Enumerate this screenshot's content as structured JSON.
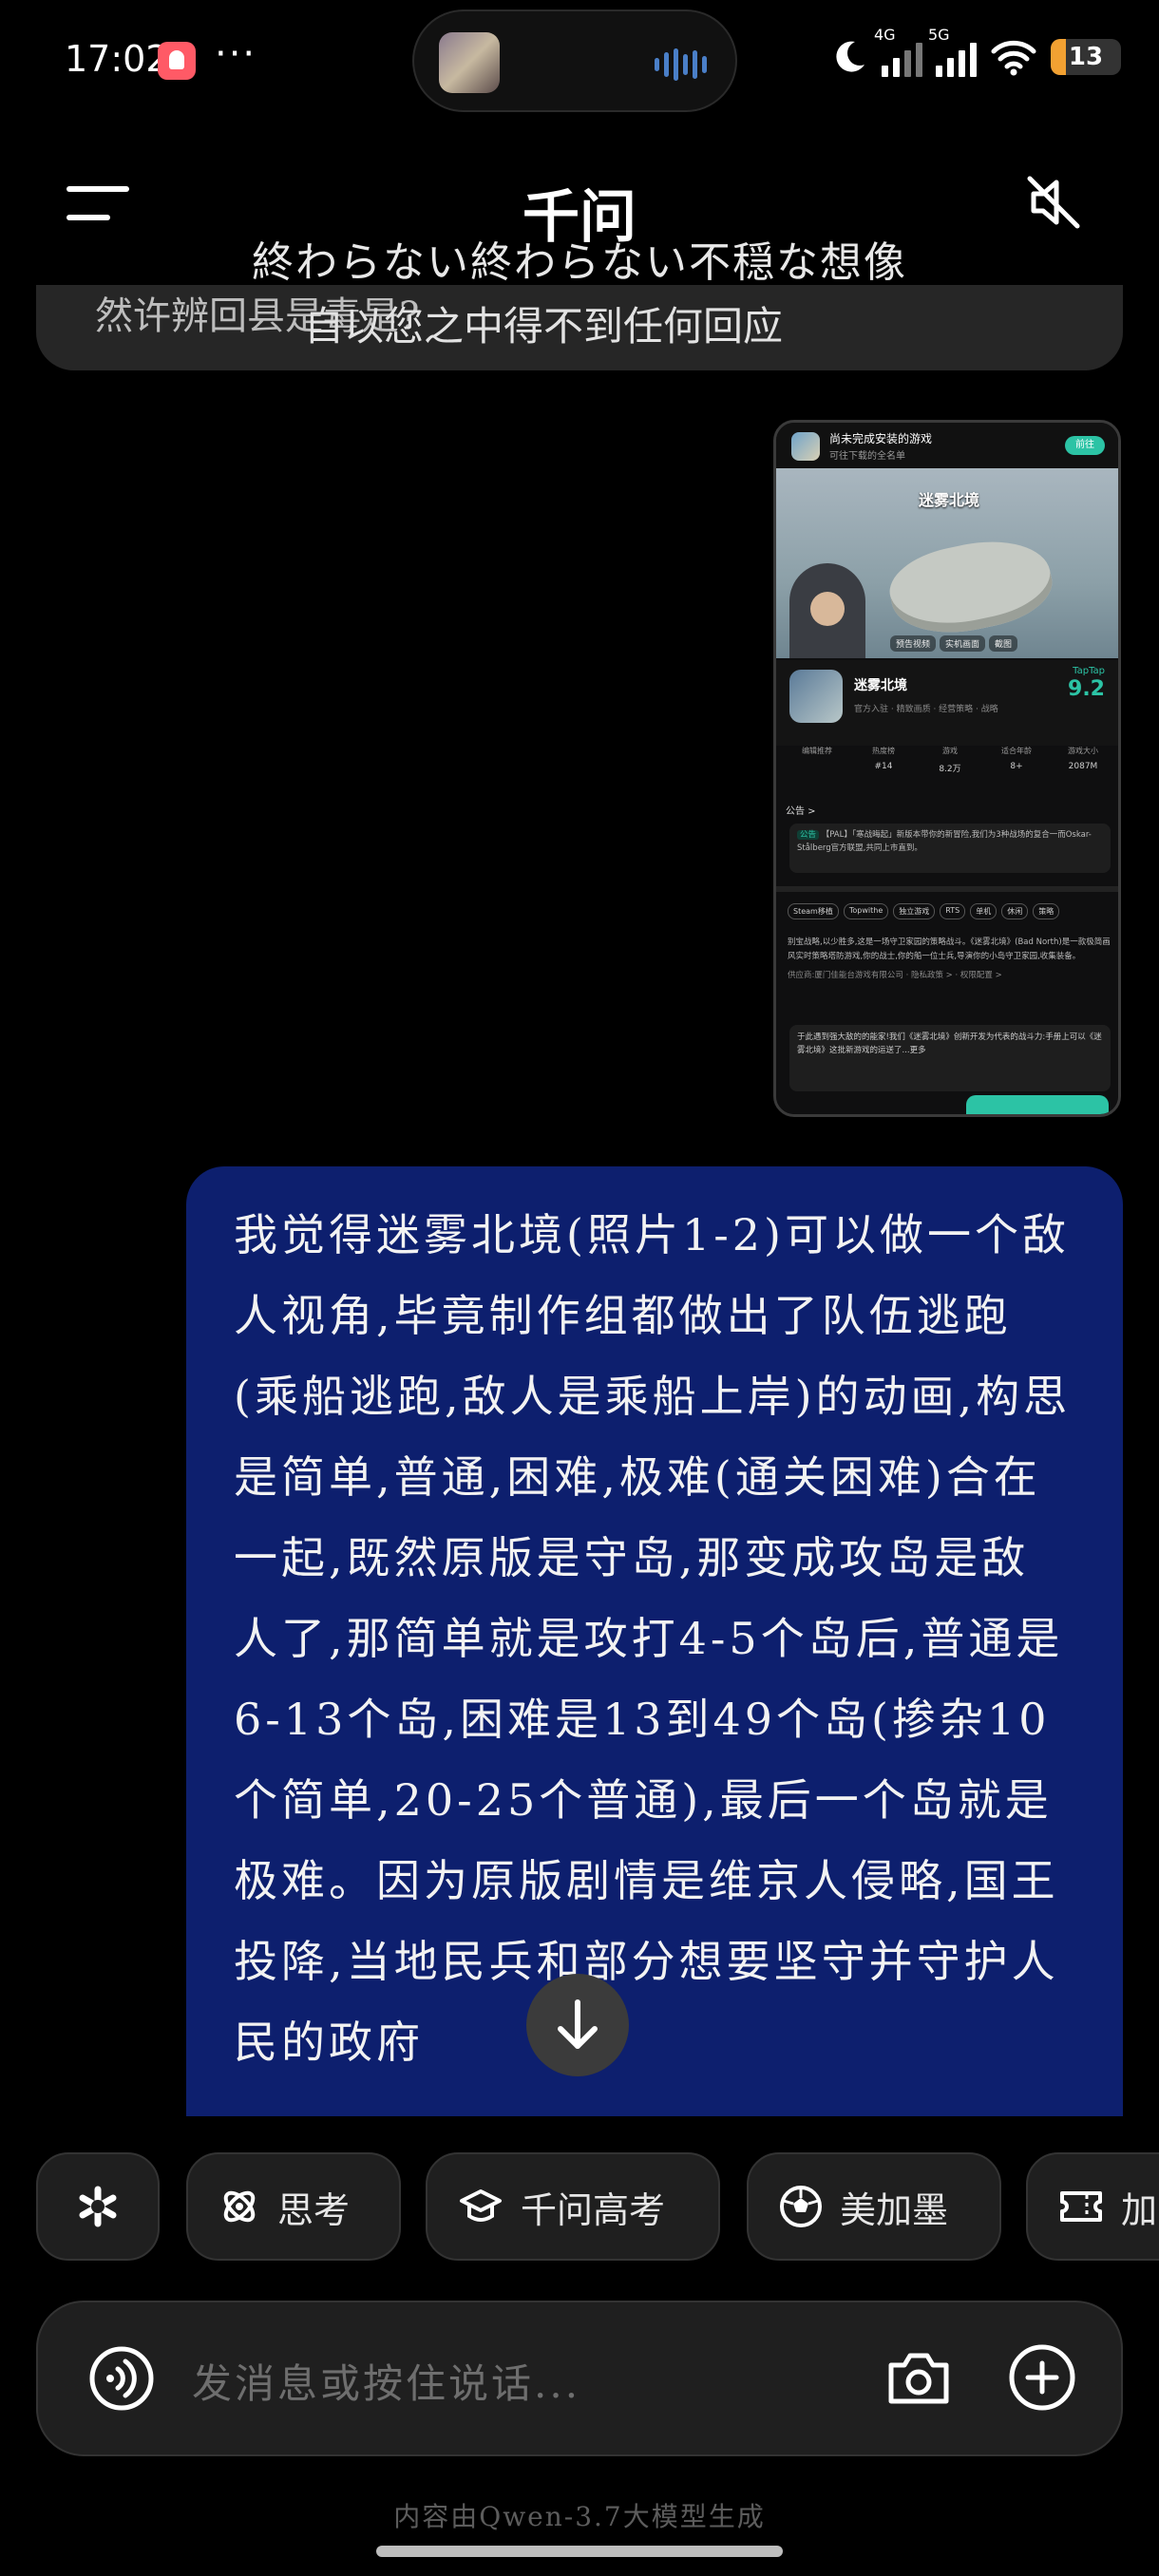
{
  "status_bar": {
    "time": "17:02",
    "dots": "···",
    "network_1": "4G",
    "network_2": "5G",
    "battery": "13"
  },
  "header": {
    "title": "千问",
    "video_subtitle": "終わらない終わらない不穏な想像"
  },
  "previous_message": {
    "partial_text_1": "然许辨回县是毒是?",
    "partial_text_2": "自以您之中得不到任何回应"
  },
  "attached_screenshot": {
    "top_title": "尚未完成安装的游戏",
    "top_subtitle": "可往下载的全名单",
    "open_button": "前往",
    "banner_title": "迷雾北境",
    "banner_tabs": [
      "预告视频",
      "实机画面",
      "截图"
    ],
    "game_name": "迷雾北境",
    "game_meta": "官方入驻 · 精致画质 · 经营策略 · 战略",
    "score_label": "TapTap",
    "score": "9.2",
    "stats": [
      {
        "k": "编辑推荐",
        "v": ""
      },
      {
        "k": "热度榜",
        "v": "#14"
      },
      {
        "k": "游戏",
        "v": "8.2万"
      },
      {
        "k": "适合年龄",
        "v": "8+"
      },
      {
        "k": "游戏大小",
        "v": "2087M"
      }
    ],
    "bulletin": "公告 >",
    "note_tag": "公告",
    "note_text": "【PAL】「寒战晦起」新版本带你的新冒险,我们为3种战场的复合一而Oskar-Stålberg官方联盟,共同上市直到。",
    "tags": [
      "Steam移植",
      "Topwithe",
      "独立游戏",
      "RTS",
      "单机",
      "休闲",
      "策略"
    ],
    "description": "别宝战略,以少胜多,这是一场守卫家园的策略战斗。《迷雾北境》(Bad North)是一款极简画风实时策略塔防游戏,你的战士,你的船一位士兵,导演你的小岛守卫家园,收集装备。",
    "dev_line": "供应商:厦门佳能台游戏有限公司 · 隐私政策 > · 权限配置 >",
    "card_text": "于此遇到强大敌的的能家!我们《迷雾北境》创新开发为代表的战斗力:手册上可以《迷雾北境》这批新游戏的运送了...更多"
  },
  "user_message": {
    "text": "我觉得迷雾北境(照片1-2)可以做一个敌人视角,毕竟制作组都做出了队伍逃跑(乘船逃跑,敌人是乘船上岸)的动画,构思是简单,普通,困难,极难(通关困难)合在一起,既然原版是守岛,那变成攻岛是敌人了,那简单就是攻打4-5个岛后,普通是6-13个岛,困难是13到49个岛(掺杂10个简单,20-25个普通),最后一个岛就是极难。因为原版剧情是维京人侵略,国王投降,当地民兵和部分想要坚守并守护人民的政府"
  },
  "quick_actions": [
    {
      "icon": "sparkle-icon",
      "label": ""
    },
    {
      "icon": "think-icon",
      "label": "思考"
    },
    {
      "icon": "graduation-cap-icon",
      "label": "千问高考"
    },
    {
      "icon": "soccer-ball-icon",
      "label": "美加墨"
    },
    {
      "icon": "ticket-icon",
      "label": "加"
    }
  ],
  "input": {
    "placeholder": "发消息或按住说话..."
  },
  "footer_note": "内容由Qwen-3.7大模型生成",
  "colors": {
    "background": "#000000",
    "user_bubble": "#0d1f6e",
    "accent_teal": "#2cc3a5",
    "battery": "#f2a132"
  }
}
